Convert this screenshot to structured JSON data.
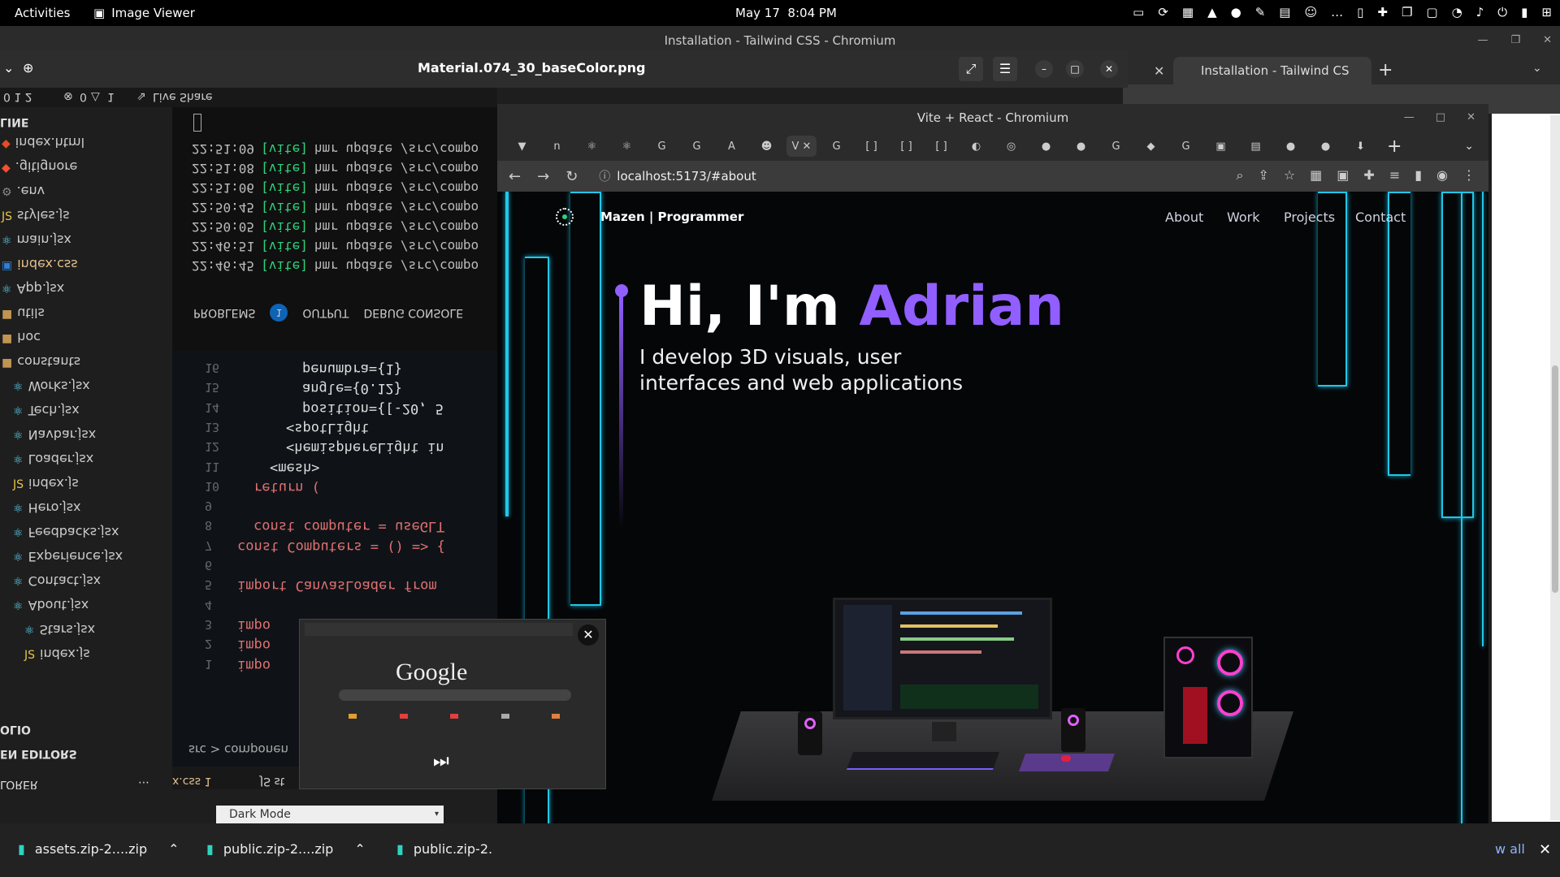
{
  "topbar": {
    "activities": "Activities",
    "app_name": "Image Viewer",
    "date": "May 17",
    "time": "8:04 PM"
  },
  "bg_window": {
    "title": "Installation - Tailwind CSS - Chromium",
    "tab_label": "Installation - Tailwind CS"
  },
  "image_viewer": {
    "title": "Material.074_30_baseColor.png",
    "statusbar": {
      "counts": "0 1 2",
      "errors": "0",
      "warnings": "1",
      "liveshare": "Live Share"
    },
    "sidebar": {
      "outline": "LINE",
      "files": [
        {
          "icon": "html-icon",
          "name": "index.html"
        },
        {
          "icon": "git-icon",
          "name": ".gitignore"
        },
        {
          "icon": "gear-icon",
          "name": ".env"
        },
        {
          "icon": "js-icon",
          "name": "styles.js"
        },
        {
          "icon": "react-icon",
          "name": "main.jsx"
        },
        {
          "icon": "css-icon",
          "name": "index.css"
        },
        {
          "icon": "react-icon",
          "name": "App.jsx"
        },
        {
          "icon": "folder-icon",
          "name": "utils"
        },
        {
          "icon": "folder-icon",
          "name": "hoc"
        },
        {
          "icon": "folder-icon",
          "name": "constants"
        },
        {
          "icon": "react-icon",
          "name": "Works.jsx"
        },
        {
          "icon": "react-icon",
          "name": "Tech.jsx"
        },
        {
          "icon": "react-icon",
          "name": "Navbar.jsx"
        },
        {
          "icon": "react-icon",
          "name": "Loader.jsx"
        },
        {
          "icon": "js-icon",
          "name": "index.js"
        },
        {
          "icon": "react-icon",
          "name": "Hero.jsx"
        },
        {
          "icon": "react-icon",
          "name": "Feedbacks.jsx"
        },
        {
          "icon": "react-icon",
          "name": "Experience.jsx"
        },
        {
          "icon": "react-icon",
          "name": "Contact.jsx"
        },
        {
          "icon": "react-icon",
          "name": "About.jsx"
        },
        {
          "icon": "react-icon",
          "name": "Stars.jsx"
        },
        {
          "icon": "js-icon",
          "name": "index.js"
        }
      ],
      "portfolio": "OLIO",
      "open_editors": "EN EDITORS",
      "explorer": "LORER"
    },
    "terminal_lines": [
      {
        "time": "22:51:09",
        "tag": "[vite]",
        "msg": "hmr update /src/compo"
      },
      {
        "time": "22:51:08",
        "tag": "[vite]",
        "msg": "hmr update /src/compo"
      },
      {
        "time": "22:51:06",
        "tag": "[vite]",
        "msg": "hmr update /src/compo"
      },
      {
        "time": "22:50:45",
        "tag": "[vite]",
        "msg": "hmr update /src/compo"
      },
      {
        "time": "22:50:05",
        "tag": "[vite]",
        "msg": "hmr update /src/compo"
      },
      {
        "time": "22:46:51",
        "tag": "[vite]",
        "msg": "hmr update /src/compo"
      },
      {
        "time": "22:46:45",
        "tag": "[vite]",
        "msg": "hmr update /src/compo"
      }
    ],
    "panel_tabs": {
      "problems": "PROBLEMS",
      "problems_count": "1",
      "output": "OUTPUT",
      "debug": "DEBUG CONSOLE"
    },
    "code_lines": [
      {
        "num": "16",
        "text": "penumbra={1}"
      },
      {
        "num": "15",
        "text": "angle={0.12}"
      },
      {
        "num": "14",
        "text": "position={[-20, 5"
      },
      {
        "num": "13",
        "text": "<spotLight"
      },
      {
        "num": "12",
        "text": "<hemisphereLight in"
      },
      {
        "num": "11",
        "text": "<mesh>"
      },
      {
        "num": "10",
        "text": "return ("
      },
      {
        "num": "9",
        "text": ""
      },
      {
        "num": "8",
        "text": "const computer = useGLT"
      },
      {
        "num": "7",
        "text": "const Computers = () => {"
      },
      {
        "num": "6",
        "text": ""
      },
      {
        "num": "5",
        "text": "import CanvasLoader from"
      },
      {
        "num": "4",
        "text": ""
      },
      {
        "num": "3",
        "text": "impo"
      },
      {
        "num": "2",
        "text": "impo"
      },
      {
        "num": "1",
        "text": "impo"
      }
    ],
    "breadcrumb": "src > componen",
    "editor_tabs": [
      "x.css 1",
      "JS st"
    ]
  },
  "front_window": {
    "title": "Vite + React - Chromium",
    "url": "localhost:5173/#about",
    "page": {
      "logo": "Mazen | Programmer",
      "nav": [
        "About",
        "Work",
        "Projects",
        "Contact"
      ],
      "greeting": "Hi, I'm ",
      "name": "Adrian",
      "subtitle": "I develop 3D visuals, user interfaces and web applications",
      "accent": "#915eff"
    }
  },
  "popup": {
    "logo_text": "Google"
  },
  "dark_mode": "Dark Mode",
  "downloads": [
    {
      "name": "assets.zip-2....zip"
    },
    {
      "name": "public.zip-2....zip"
    },
    {
      "name": "public.zip-2."
    }
  ],
  "show_all": "w all"
}
